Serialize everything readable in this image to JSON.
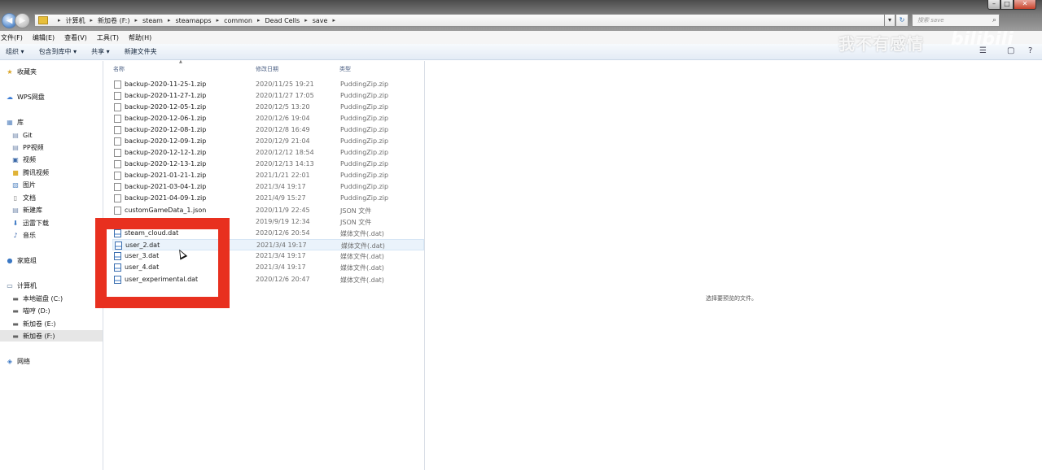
{
  "address": {
    "crumbs": [
      "计算机",
      "新加卷 (F:)",
      "steam",
      "steamapps",
      "common",
      "Dead Cells",
      "save"
    ],
    "search_placeholder": "搜索 save"
  },
  "menu": [
    "文件(F)",
    "编辑(E)",
    "查看(V)",
    "工具(T)",
    "帮助(H)"
  ],
  "toolbar": {
    "organize": "组织 ▾",
    "include_library": "包含到库中 ▾",
    "share": "共享 ▾",
    "new_folder": "新建文件夹"
  },
  "watermark": {
    "text": "我不有感情",
    "logo": "bilibili"
  },
  "navpane": {
    "favorites": "收藏夹",
    "wps": "WPS网盘",
    "library": "库",
    "git": "Git",
    "pp": "PP视频",
    "video": "视频",
    "tencent": "腾讯视频",
    "pictures": "图片",
    "docs": "文档",
    "newlib": "新建库",
    "xunlei": "迅雷下载",
    "music": "音乐",
    "homegroup": "家庭组",
    "computer": "计算机",
    "drive_c": "本地磁盘 (C:)",
    "drive_d": "喵哼 (D:)",
    "drive_e": "新加卷 (E:)",
    "drive_f": "新加卷 (F:)",
    "network": "网络"
  },
  "columns": {
    "name": "名称",
    "date": "修改日期",
    "type": "类型"
  },
  "files": [
    {
      "name": "backup-2020-11-25-1.zip",
      "date": "2020/11/25 19:21",
      "type": "PuddingZip.zip"
    },
    {
      "name": "backup-2020-11-27-1.zip",
      "date": "2020/11/27 17:05",
      "type": "PuddingZip.zip"
    },
    {
      "name": "backup-2020-12-05-1.zip",
      "date": "2020/12/5 13:20",
      "type": "PuddingZip.zip"
    },
    {
      "name": "backup-2020-12-06-1.zip",
      "date": "2020/12/6 19:04",
      "type": "PuddingZip.zip"
    },
    {
      "name": "backup-2020-12-08-1.zip",
      "date": "2020/12/8 16:49",
      "type": "PuddingZip.zip"
    },
    {
      "name": "backup-2020-12-09-1.zip",
      "date": "2020/12/9 21:04",
      "type": "PuddingZip.zip"
    },
    {
      "name": "backup-2020-12-12-1.zip",
      "date": "2020/12/12 18:54",
      "type": "PuddingZip.zip"
    },
    {
      "name": "backup-2020-12-13-1.zip",
      "date": "2020/12/13 14:13",
      "type": "PuddingZip.zip"
    },
    {
      "name": "backup-2021-01-21-1.zip",
      "date": "2021/1/21 22:01",
      "type": "PuddingZip.zip"
    },
    {
      "name": "backup-2021-03-04-1.zip",
      "date": "2021/3/4 19:17",
      "type": "PuddingZip.zip"
    },
    {
      "name": "backup-2021-04-09-1.zip",
      "date": "2021/4/9 15:27",
      "type": "PuddingZip.zip"
    },
    {
      "name": "customGameData_1.json",
      "date": "2020/11/9 22:45",
      "type": "JSON 文件"
    },
    {
      "name": "",
      "date": "2019/9/19 12:34",
      "type": "JSON 文件"
    },
    {
      "name": "steam_cloud.dat",
      "date": "2020/12/6 20:54",
      "type": "媒体文件(.dat)"
    },
    {
      "name": "user_2.dat",
      "date": "2021/3/4 19:17",
      "type": "媒体文件(.dat)"
    },
    {
      "name": "user_3.dat",
      "date": "2021/3/4 19:17",
      "type": "媒体文件(.dat)"
    },
    {
      "name": "user_4.dat",
      "date": "2021/3/4 19:17",
      "type": "媒体文件(.dat)"
    },
    {
      "name": "user_experimental.dat",
      "date": "2020/12/6 20:47",
      "type": "媒体文件(.dat)"
    }
  ],
  "preview_text": "选择要预览的文件。"
}
